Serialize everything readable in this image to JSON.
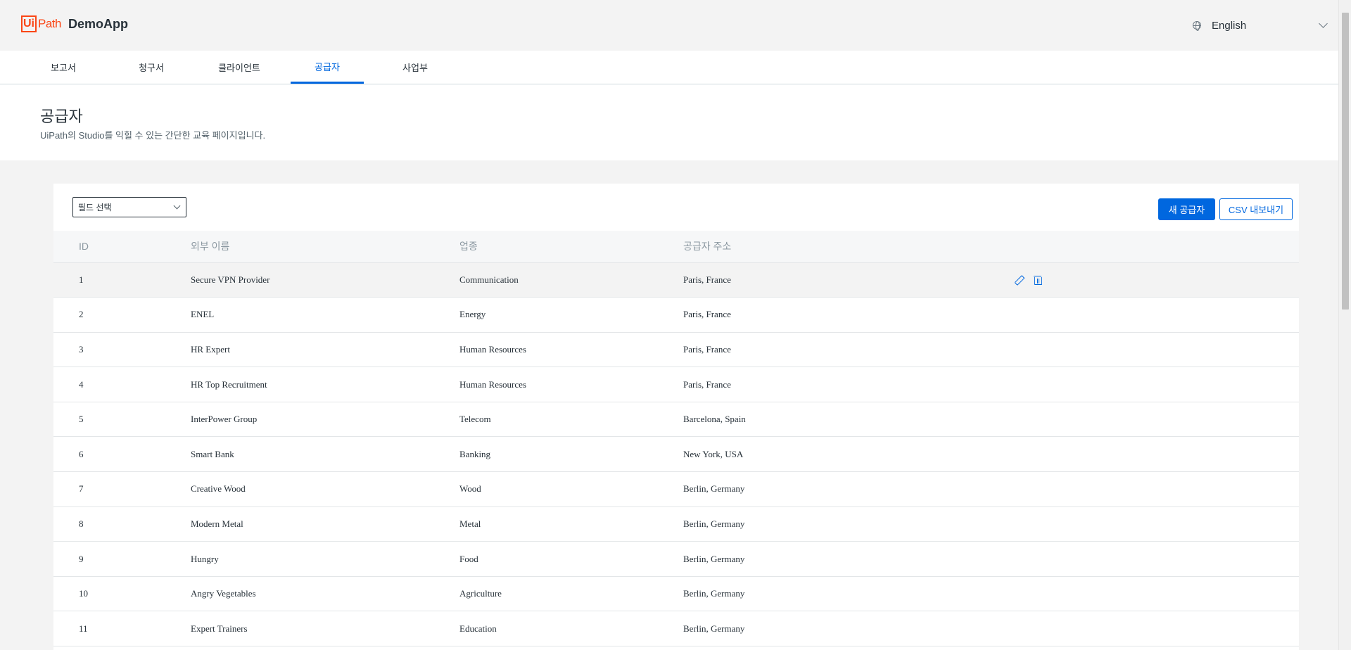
{
  "app": {
    "logo_mark": "Ui",
    "logo_path": "Path",
    "app_name": "DemoApp"
  },
  "language": {
    "icon": "globe-icon",
    "selected": "English"
  },
  "tabs": [
    {
      "label": "보고서"
    },
    {
      "label": "청구서"
    },
    {
      "label": "클라이언트"
    },
    {
      "label": "공급자",
      "active": true
    },
    {
      "label": "사업부"
    }
  ],
  "page": {
    "title": "공급자",
    "subtitle": "UiPath의 Studio를 익힐 수 있는 간단한 교육 페이지입니다."
  },
  "toolbar": {
    "field_select": "필드 선택",
    "new_button": "새 공급자",
    "export_button": "CSV 내보내기"
  },
  "table": {
    "headers": {
      "id": "ID",
      "name": "외부 이름",
      "industry": "업종",
      "address": "공급자 주소"
    },
    "rows": [
      {
        "id": "1",
        "name": "Secure VPN Provider",
        "industry": "Communication",
        "address": "Paris, France"
      },
      {
        "id": "2",
        "name": "ENEL",
        "industry": "Energy",
        "address": "Paris, France"
      },
      {
        "id": "3",
        "name": "HR Expert",
        "industry": "Human Resources",
        "address": "Paris, France"
      },
      {
        "id": "4",
        "name": "HR Top Recruitment",
        "industry": "Human Resources",
        "address": "Paris, France"
      },
      {
        "id": "5",
        "name": "InterPower Group",
        "industry": "Telecom",
        "address": "Barcelona, Spain"
      },
      {
        "id": "6",
        "name": "Smart Bank",
        "industry": "Banking",
        "address": "New York, USA"
      },
      {
        "id": "7",
        "name": "Creative Wood",
        "industry": "Wood",
        "address": "Berlin, Germany"
      },
      {
        "id": "8",
        "name": "Modern Metal",
        "industry": "Metal",
        "address": "Berlin, Germany"
      },
      {
        "id": "9",
        "name": "Hungry",
        "industry": "Food",
        "address": "Berlin, Germany"
      },
      {
        "id": "10",
        "name": "Angry Vegetables",
        "industry": "Agriculture",
        "address": "Berlin, Germany"
      },
      {
        "id": "11",
        "name": "Expert Trainers",
        "industry": "Education",
        "address": "Berlin, Germany"
      }
    ]
  },
  "colors": {
    "accent": "#0067df",
    "brand": "#fa4616",
    "text": "#273139"
  }
}
